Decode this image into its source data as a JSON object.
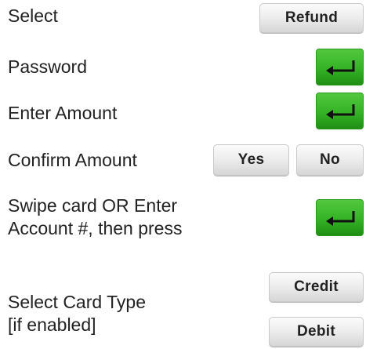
{
  "rows": {
    "select": {
      "label": "Select",
      "button_label": "Refund"
    },
    "password": {
      "label": "Password",
      "button_icon": "enter-arrow-icon"
    },
    "enter_amount": {
      "label": "Enter Amount",
      "button_icon": "enter-arrow-icon"
    },
    "confirm_amount": {
      "label": "Confirm Amount",
      "yes_label": "Yes",
      "no_label": "No"
    },
    "swipe_card": {
      "label_line1": "Swipe card OR Enter",
      "label_line2": "Account #, then press",
      "button_icon": "enter-arrow-icon"
    },
    "card_type": {
      "label_line1": "Select Card Type",
      "label_line2": "[if enabled]",
      "credit_label": "Credit",
      "debit_label": "Debit"
    }
  },
  "colors": {
    "enter_green": "#35b226",
    "button_gray": "#e6e6e6",
    "text": "#222222"
  }
}
